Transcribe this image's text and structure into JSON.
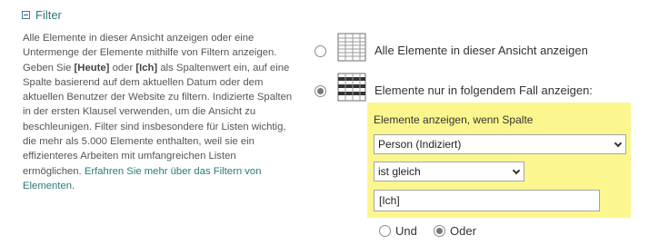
{
  "section": {
    "title": "Filter",
    "description_html_parts": {
      "p1": "Alle Elemente in dieser Ansicht anzeigen oder eine Untermenge der Elemente mithilfe von Filtern anzeigen. Geben Sie ",
      "heute": "[Heute]",
      "p2": " oder ",
      "ich": "[Ich]",
      "p3": " als Spaltenwert ein, auf eine Spalte basierend auf dem aktuellen Datum oder dem aktuellen Benutzer der Website zu filtern. Indizierte Spalten in der ersten Klausel verwenden, um die Ansicht zu beschleunigen. Filter sind insbesondere für Listen wichtig, die mehr als 5.000 Elemente enthalten, weil sie ein effizienteres Arbeiten mit umfangreichen Listen ermöglichen. ",
      "link": "Erfahren Sie mehr über das Filtern von Elementen",
      "end": "."
    }
  },
  "options": {
    "all_label": "Alle Elemente in dieser Ansicht anzeigen",
    "filtered_label": "Elemente nur in folgendem Fall anzeigen:",
    "selected": "filtered"
  },
  "filter": {
    "title": "Elemente anzeigen, wenn Spalte",
    "column_value": "Person (Indiziert)",
    "operator_value": "ist gleich",
    "value": "[Ich]"
  },
  "logic": {
    "and_label": "Und",
    "or_label": "Oder",
    "selected": "or"
  },
  "colors": {
    "accent_link": "#2a7a78",
    "panel_highlight": "#fbf78e"
  },
  "icons": [
    "collapse-minus-icon",
    "table-all-icon",
    "table-filtered-icon",
    "chevron-down-icon"
  ]
}
